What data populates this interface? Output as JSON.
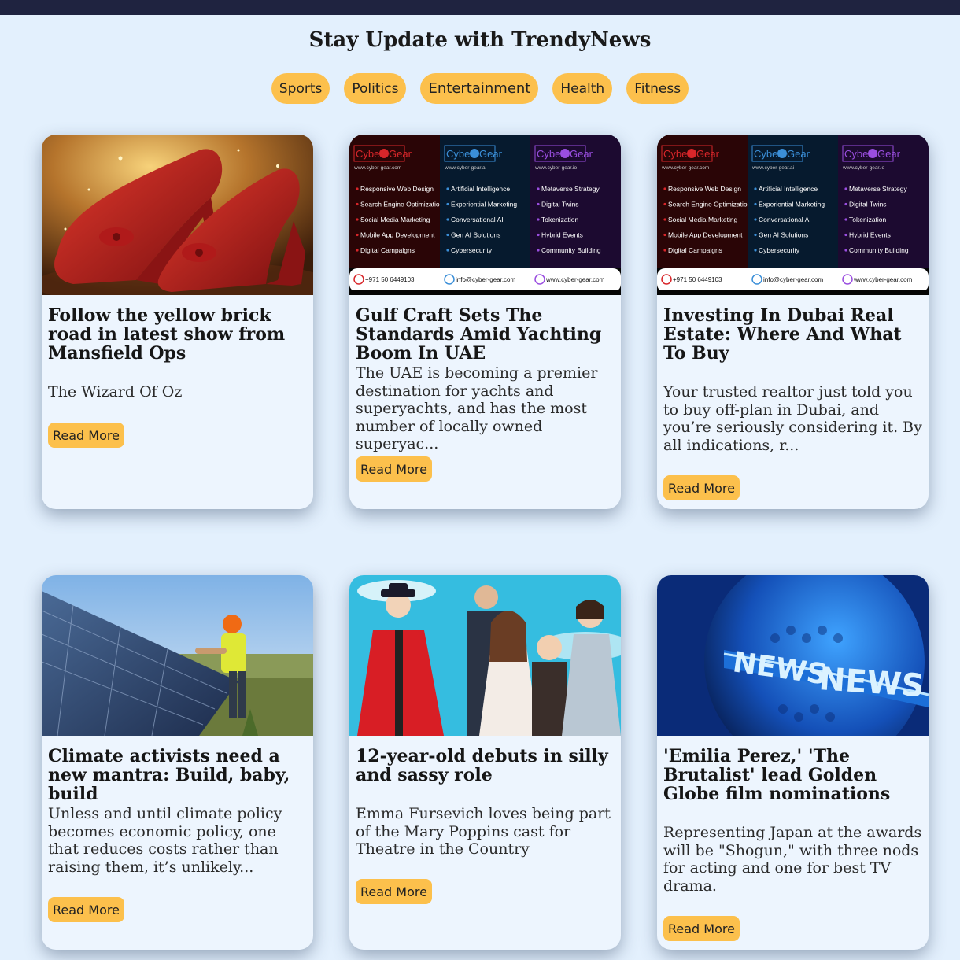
{
  "site": {
    "title": "Stay Update with TrendyNews"
  },
  "categories": [
    {
      "label": "Sports"
    },
    {
      "label": "Politics"
    },
    {
      "label": "Entertainment"
    },
    {
      "label": "Health"
    },
    {
      "label": "Fitness"
    }
  ],
  "cards": [
    {
      "title": "Follow the yellow brick road in latest show from Mansfield Ops",
      "description": "The Wizard Of Oz",
      "read_more": "Read More",
      "image": "ruby-slippers"
    },
    {
      "title": "Gulf Craft Sets The Standards Amid Yachting Boom In UAE",
      "description": "The UAE is becoming a premier destination for yachts and superyachts, and has the most number of locally owned superyac...",
      "read_more": "Read More",
      "image": "cyber-gear-ad"
    },
    {
      "title": "Investing In Dubai Real Estate: Where And What To Buy",
      "description": "Your trusted realtor just told you to buy off-plan in Dubai, and you’re seriously considering it. By all indications, r...",
      "read_more": "Read More",
      "image": "cyber-gear-ad"
    },
    {
      "title": "Climate activists need a new mantra: Build, baby, build",
      "description": "Unless and until climate policy becomes economic policy, one that reduces costs rather than raising them, it’s unlikely...",
      "read_more": "Read More",
      "image": "solar-worker"
    },
    {
      "title": "12-year-old debuts in silly and sassy role",
      "description": "Emma Fursevich loves being part of the Mary Poppins cast for Theatre in the Country",
      "read_more": "Read More",
      "image": "mary-poppins-cast"
    },
    {
      "title": "'Emilia Perez,' 'The Brutalist' lead Golden Globe film nominations",
      "description": "Representing Japan at the awards will be \"Shogun,\" with three nods for acting and one for best TV drama.",
      "read_more": "Read More",
      "image": "news-globe"
    }
  ],
  "cyber_ad": {
    "columns": [
      {
        "brand_a": "Cyber",
        "brand_b": "Gear",
        "site": "www.cyber-gear.com",
        "accent": "#d8262a",
        "items": [
          "Responsive Web Design",
          "Search Engine Optimization",
          "Social Media Marketing",
          "Mobile App Development",
          "Digital Campaigns"
        ],
        "contact": "+971 50 6449103"
      },
      {
        "brand_a": "Cyber",
        "brand_b": "Gear",
        "site": "www.cyber-gear.ai",
        "accent": "#3b8fd8",
        "items": [
          "Artificial Intelligence",
          "Experiential Marketing",
          "Conversational AI",
          "Gen AI Solutions",
          "Cybersecurity"
        ],
        "contact": "info@cyber-gear.com"
      },
      {
        "brand_a": "Cyber",
        "brand_b": "Gear",
        "site": "www.cyber-gear.io",
        "accent": "#9a4ee0",
        "items": [
          "Metaverse Strategy",
          "Digital Twins",
          "Tokenization",
          "Hybrid Events",
          "Community Building"
        ],
        "contact": "www.cyber-gear.com"
      }
    ]
  },
  "news_globe": {
    "word": "NEWS"
  },
  "colors": {
    "background": "#e3f0fd",
    "topbar": "#1f2340",
    "pill": "#fcc04c",
    "card": "#edf5fe"
  }
}
